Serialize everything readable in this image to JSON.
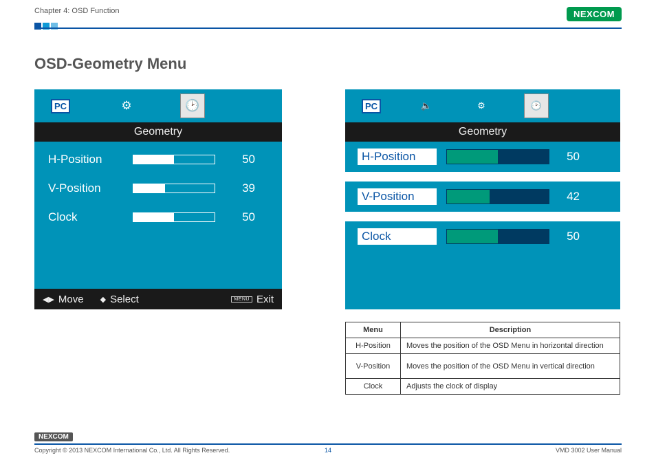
{
  "header": {
    "chapter": "Chapter 4: OSD Function",
    "brand": "NEXCOM"
  },
  "title": "OSD-Geometry Menu",
  "left_panel": {
    "tabs": [
      {
        "name": "PC",
        "selected": false
      },
      {
        "name": "gear-icon",
        "selected": false
      },
      {
        "name": "clock-icon",
        "selected": true
      }
    ],
    "subtitle": "Geometry",
    "rows": [
      {
        "label": "H-Position",
        "value": 50,
        "fill_pct": 50
      },
      {
        "label": "V-Position",
        "value": 39,
        "fill_pct": 39
      },
      {
        "label": "Clock",
        "value": 50,
        "fill_pct": 50
      }
    ],
    "footer": {
      "move": "Move",
      "select": "Select",
      "menu_tag": "MENU",
      "exit": "Exit"
    }
  },
  "right_panel": {
    "tabs": [
      {
        "name": "PC",
        "selected": false
      },
      {
        "name": "speaker-icon",
        "selected": false
      },
      {
        "name": "gear-icon",
        "selected": false
      },
      {
        "name": "clock-icon",
        "selected": true
      }
    ],
    "subtitle": "Geometry",
    "rows": [
      {
        "label": "H-Position",
        "value": 50,
        "fill_pct": 50
      },
      {
        "label": "V-Position",
        "value": 42,
        "fill_pct": 42
      },
      {
        "label": "Clock",
        "value": 50,
        "fill_pct": 50
      }
    ]
  },
  "desc_table": {
    "head": {
      "menu": "Menu",
      "desc": "Description"
    },
    "rows": [
      {
        "menu": "H-Position",
        "desc": "Moves the position of the OSD Menu in horizontal direction"
      },
      {
        "menu": "V-Position",
        "desc": "Moves the position of the OSD Menu in vertical direction"
      },
      {
        "menu": "Clock",
        "desc": "Adjusts the clock of display"
      }
    ]
  },
  "footer": {
    "brand": "NEXCOM",
    "copyright": "Copyright © 2013 NEXCOM International Co., Ltd. All Rights Reserved.",
    "page_number": "14",
    "manual": "VMD 3002 User Manual"
  }
}
